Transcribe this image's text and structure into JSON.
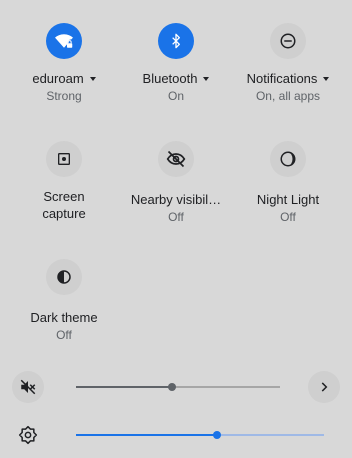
{
  "tiles": [
    {
      "id": "wifi",
      "label": "eduroam",
      "sub": "Strong",
      "active": true,
      "icon": "wifi-lock-icon",
      "has_menu": true
    },
    {
      "id": "bluetooth",
      "label": "Bluetooth",
      "sub": "On",
      "active": true,
      "icon": "bluetooth-icon",
      "has_menu": true
    },
    {
      "id": "notifications",
      "label": "Notifications",
      "sub": "On, all apps",
      "active": false,
      "icon": "do-not-disturb-icon",
      "has_menu": true
    },
    {
      "id": "screen_capture",
      "label": "Screen capture",
      "sub": "",
      "active": false,
      "icon": "screen-capture-icon",
      "has_menu": false
    },
    {
      "id": "nearby",
      "label": "Nearby visibil…",
      "sub": "Off",
      "active": false,
      "icon": "eye-off-icon",
      "has_menu": false
    },
    {
      "id": "night_light",
      "label": "Night Light",
      "sub": "Off",
      "active": false,
      "icon": "night-light-icon",
      "has_menu": false
    },
    {
      "id": "dark_theme",
      "label": "Dark theme",
      "sub": "Off",
      "active": false,
      "icon": "dark-theme-icon",
      "has_menu": false
    }
  ],
  "volume": {
    "icon": "volume-muted-icon",
    "level": 0.47,
    "muted": true,
    "expand_icon": "chevron-right-icon"
  },
  "brightness": {
    "icon": "brightness-icon",
    "level": 0.568
  },
  "colors": {
    "accent": "#1a73e8",
    "tile_bg": "#cfcfcf",
    "muted_track": "#8d8d8d",
    "muted_thumb": "#5f6368",
    "background": "#d8d8d8"
  }
}
